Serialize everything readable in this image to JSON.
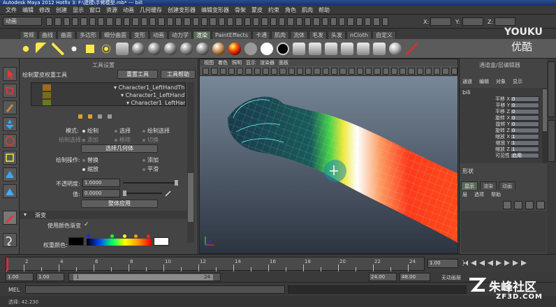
{
  "window": {
    "title": "Autodesk Maya 2012 Hotfix 3: F:\\建模\\手臂模型.mb* --- bill"
  },
  "menu": [
    "文件",
    "编辑",
    "修改",
    "创建",
    "显示",
    "窗口",
    "资源",
    "动画",
    "几何缓存",
    "创建变形器",
    "编辑变形器",
    "骨架",
    "蒙皮",
    "约束",
    "角色",
    "肌肉",
    "帮助"
  ],
  "mode_menu": "动画",
  "status": {
    "x_label": "X:",
    "y_label": "Y:",
    "z_label": "Z:"
  },
  "shelf_tabs": [
    "常规",
    "曲线",
    "曲面",
    "多边形",
    "细分曲面",
    "变形",
    "动画",
    "动力学",
    "渲染",
    "PaintEffects",
    "卡通",
    "肌肉",
    "流体",
    "毛发",
    "头发",
    "nCloth",
    "自定义"
  ],
  "shelf_active": "渲染",
  "tool_settings": {
    "header": "工具设置",
    "tool_name": "绘制蒙皮权重工具",
    "reset_button": "重置工具",
    "help_button": "工具帮助",
    "influences": [
      "Character1_LeftHandThumb",
      "Character1_LeftHandThu",
      "Character1_LeftHandT"
    ],
    "mode_label": "模式:",
    "mode_options": [
      "绘制",
      "选择",
      "绘制选择"
    ],
    "paint_select_label": "绘制选择:",
    "paint_select_options": [
      "添加",
      "移除",
      "切换"
    ],
    "select_geometry_button": "选择几何体",
    "paint_op_label": "绘制操作:",
    "paint_op_options": [
      "替换",
      "添加",
      "缩放",
      "平滑"
    ],
    "opacity_label": "不透明度:",
    "opacity_value": "1.0000",
    "value_label": "值:",
    "value_value": "0.0000",
    "flood_button": "整体应用",
    "gradient_section": "渐变",
    "use_color_ramp_label": "使用颜色渐变",
    "ramp_color_label": "权重颜色:"
  },
  "viewport_menu": [
    "视图",
    "着色",
    "照明",
    "显示",
    "渲染器",
    "面板"
  ],
  "channel_box": {
    "header": "通道盒/层编辑器",
    "menu": [
      "通道",
      "编辑",
      "对象",
      "显示"
    ],
    "object": "bili",
    "channels": [
      {
        "name": "平移 X",
        "value": "0"
      },
      {
        "name": "平移 Y",
        "value": "0"
      },
      {
        "name": "平移 Z",
        "value": "0"
      },
      {
        "name": "旋转 X",
        "value": "0"
      },
      {
        "name": "旋转 Y",
        "value": "0"
      },
      {
        "name": "旋转 Z",
        "value": "0"
      },
      {
        "name": "缩放 X",
        "value": "1"
      },
      {
        "name": "缩放 Y",
        "value": "1"
      },
      {
        "name": "缩放 Z",
        "value": "1"
      },
      {
        "name": "可见性",
        "value": "启用"
      }
    ],
    "shapes_label": "形状",
    "layer_tabs": [
      "显示",
      "渲染",
      "动画"
    ],
    "layer_menu": [
      "层",
      "选项",
      "帮助"
    ]
  },
  "timeline": {
    "ticks": [
      "2",
      "4",
      "6",
      "8",
      "10",
      "12",
      "14",
      "16",
      "18",
      "20",
      "22",
      "24"
    ],
    "current_frame": "1.00"
  },
  "range": {
    "start": "1.00",
    "start2": "1.00",
    "range_start": "1",
    "range_end": "24",
    "end": "24.00",
    "end2": "48.00",
    "anim_layer": "无动画层"
  },
  "mel_label": "MEL",
  "help_line": "选择: 42.230",
  "watermarks": {
    "youku": "YOUKU",
    "youku_cn": "优酷",
    "site_cn": "朱峰社区",
    "site": "ZF3D.COM"
  }
}
